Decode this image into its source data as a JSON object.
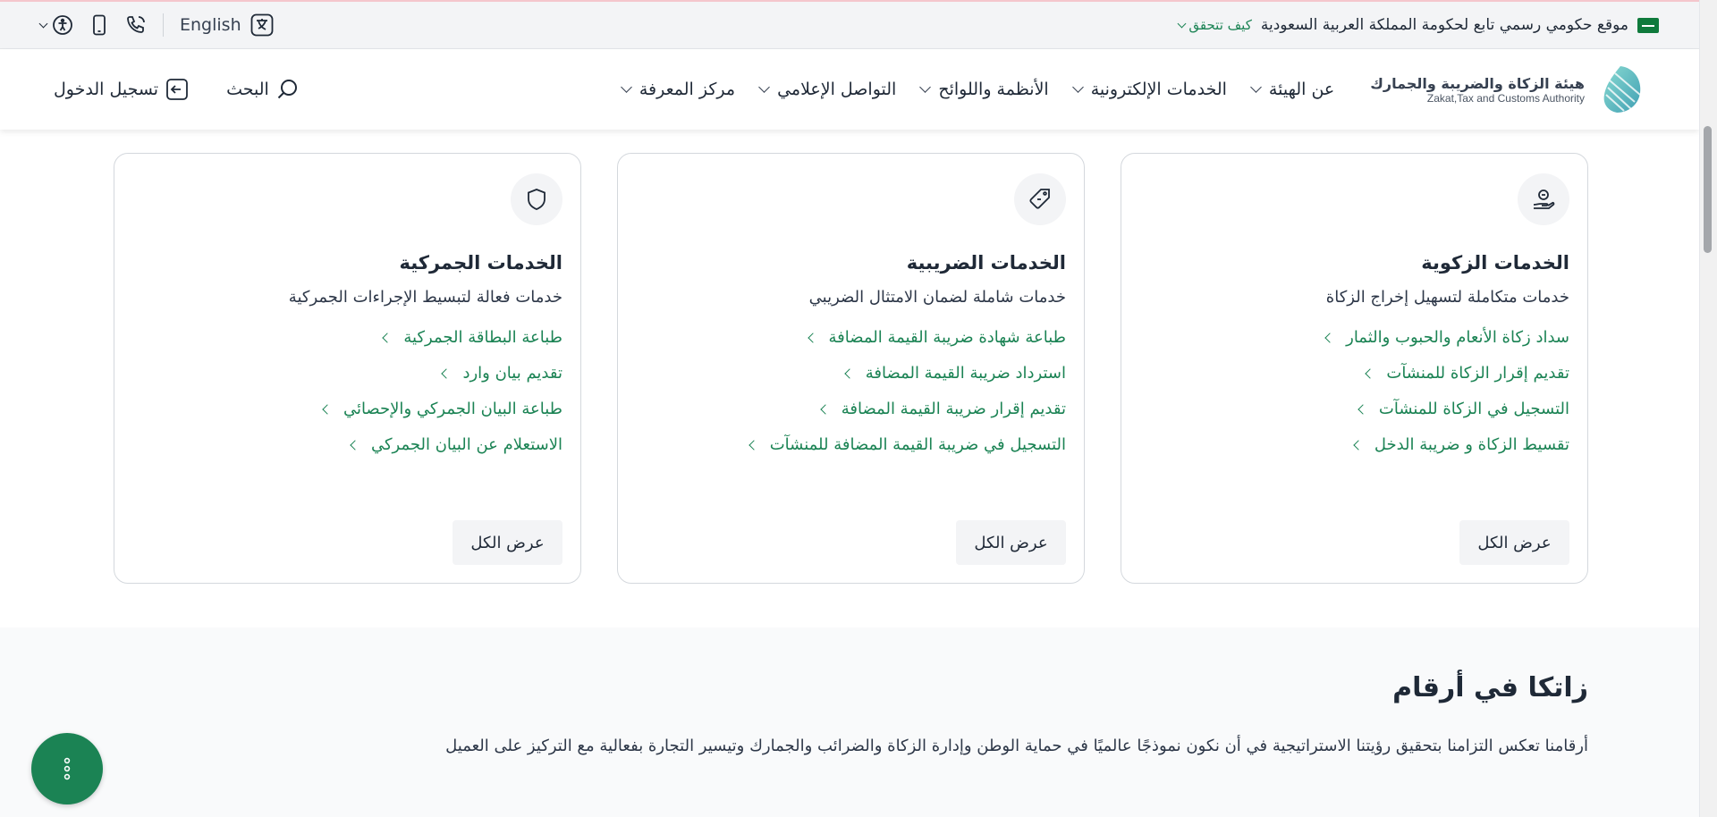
{
  "gov_bar": {
    "official_text": "موقع حكومي رسمي تابع لحكومة المملكة العربية السعودية",
    "how_to_verify": "كيف تتحقق",
    "language": "English"
  },
  "header": {
    "brand_ar": "هيئة الزكاة والضريبة والجمارك",
    "brand_en": "Zakat,Tax and Customs Authority",
    "nav": [
      {
        "label": "عن الهيئة"
      },
      {
        "label": "الخدمات الإلكترونية"
      },
      {
        "label": "الأنظمة واللوائح"
      },
      {
        "label": "التواصل الإعلامي"
      },
      {
        "label": "مركز المعرفة"
      }
    ],
    "search_label": "البحث",
    "login_label": "تسجيل الدخول"
  },
  "cards": [
    {
      "icon": "hand-coin-icon",
      "title": "الخدمات الزكوية",
      "subtitle": "خدمات متكاملة لتسهيل إخراج الزكاة",
      "links": [
        "سداد زكاة الأنعام والحبوب والثمار",
        "تقديم إقرار الزكاة للمنشآت",
        "التسجيل في الزكاة للمنشآت",
        "تقسيط الزكاة و ضريبة الدخل"
      ],
      "view_all": "عرض الكل"
    },
    {
      "icon": "tag-icon",
      "title": "الخدمات الضريبية",
      "subtitle": "خدمات شاملة لضمان الامتثال الضريبي",
      "links": [
        "طباعة شهادة ضريبة القيمة المضافة",
        "استرداد ضريبة القيمة المضافة",
        "تقديم إقرار ضريبة القيمة المضافة",
        "التسجيل في ضريبة القيمة المضافة للمنشآت"
      ],
      "view_all": "عرض الكل"
    },
    {
      "icon": "shield-icon",
      "title": "الخدمات الجمركية",
      "subtitle": "خدمات فعالة لتبسيط الإجراءات الجمركية",
      "links": [
        "طباعة البطاقة الجمركية",
        "تقديم بيان وارد",
        "طباعة البيان الجمركي والإحصائي",
        "الاستعلام عن البيان الجمركي"
      ],
      "view_all": "عرض الكل"
    }
  ],
  "numbers": {
    "title": "زاتكا في أرقام",
    "description": "أرقامنا تعكس التزامنا بتحقيق رؤيتنا الاستراتيجية في أن نكون نموذجًا عالميًا في حماية الوطن وإدارة الزكاة والضرائب والجمارك وتيسير التجارة بفعالية مع التركيز على العميل"
  },
  "colors": {
    "accent": "#1b8354",
    "text": "#1f2937"
  }
}
